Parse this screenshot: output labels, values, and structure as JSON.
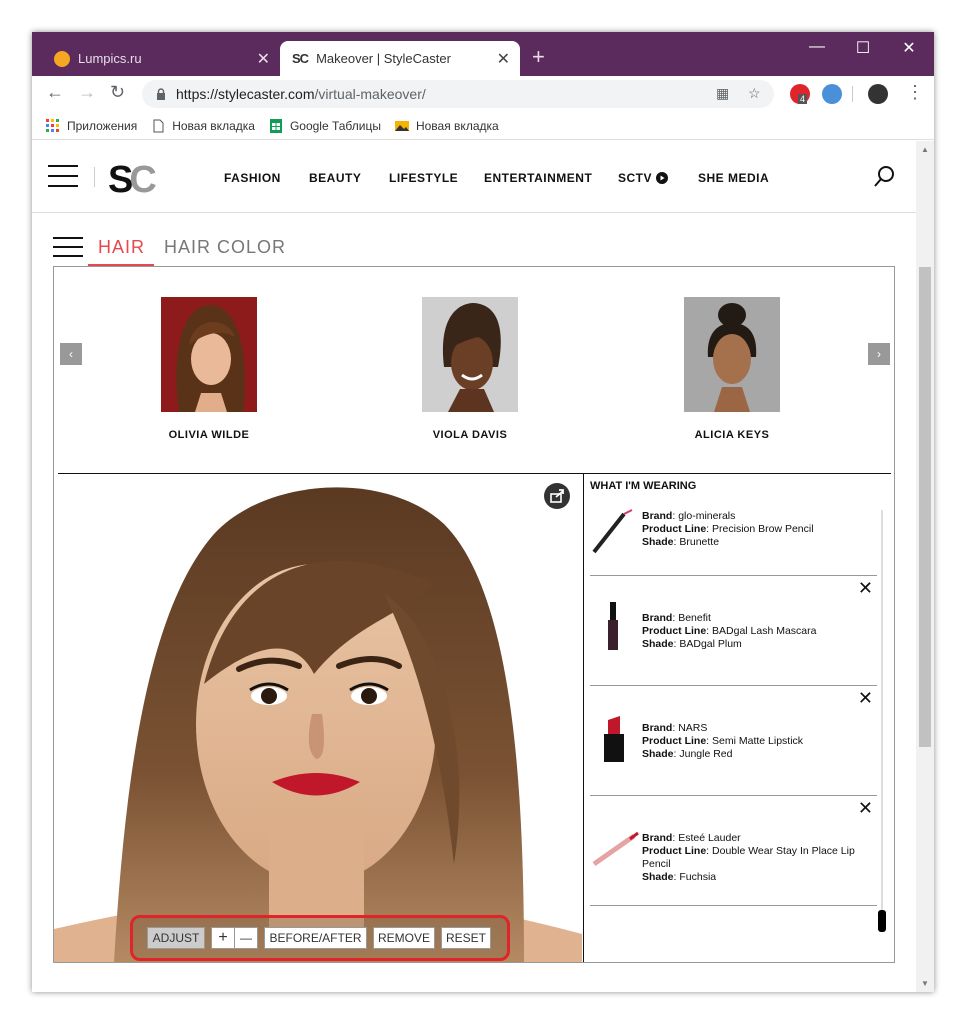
{
  "browser": {
    "tabs": [
      {
        "title": "Lumpics.ru",
        "active": false
      },
      {
        "title": "Makeover | StyleCaster",
        "active": true,
        "favicon_text": "SC"
      }
    ],
    "new_tab_symbol": "+",
    "window_controls": {
      "minimize": "—",
      "maximize": "☐",
      "close": "✕"
    },
    "url": {
      "host": "https://stylecaster.com",
      "path": "/virtual-makeover/"
    },
    "extension_badge": "4",
    "bookmarks": [
      {
        "label": "Приложения",
        "icon": "apps-grid-icon"
      },
      {
        "label": "Новая вкладка",
        "icon": "page-icon"
      },
      {
        "label": "Google Таблицы",
        "icon": "sheets-icon"
      },
      {
        "label": "Новая вкладка",
        "icon": "image-icon"
      }
    ]
  },
  "site": {
    "logo": {
      "s": "S",
      "c": "C"
    },
    "nav": [
      {
        "label": "FASHION"
      },
      {
        "label": "BEAUTY"
      },
      {
        "label": "LIFESTYLE"
      },
      {
        "label": "ENTERTAINMENT"
      },
      {
        "label": "SCTV"
      },
      {
        "label": "SHE MEDIA"
      }
    ]
  },
  "makeover": {
    "tabs": [
      {
        "label": "HAIR",
        "active": true
      },
      {
        "label": "HAIR COLOR",
        "active": false
      }
    ],
    "carousel": {
      "prev": "‹",
      "next": "›",
      "celebrities": [
        {
          "name": "OLIVIA WILDE"
        },
        {
          "name": "VIOLA DAVIS"
        },
        {
          "name": "ALICIA KEYS"
        }
      ]
    },
    "wearing": {
      "title": "WHAT I'M WEARING",
      "labels": {
        "brand": "Brand",
        "line": "Product Line",
        "shade": "Shade"
      },
      "items": [
        {
          "brand": "glo-minerals",
          "line": "Precision Brow Pencil",
          "shade": "Brunette",
          "removable": false
        },
        {
          "brand": "Benefit",
          "line": "BADgal Lash Mascara",
          "shade": "BADgal Plum",
          "removable": true
        },
        {
          "brand": "NARS",
          "line": "Semi Matte Lipstick",
          "shade": "Jungle Red",
          "removable": true
        },
        {
          "brand": "Esteé Lauder",
          "line": "Double Wear Stay In Place Lip Pencil",
          "shade": "Fuchsia",
          "removable": true
        }
      ],
      "close_symbol": "✕"
    },
    "controls": {
      "adjust": "ADJUST",
      "zoom_in": "+",
      "zoom_out": "—",
      "before_after": "BEFORE/AFTER",
      "remove": "REMOVE",
      "reset": "RESET"
    }
  },
  "colors": {
    "titlebar": "#5a2b5c",
    "accent_red": "#e0242b",
    "hair_tab": "#e5484d"
  }
}
